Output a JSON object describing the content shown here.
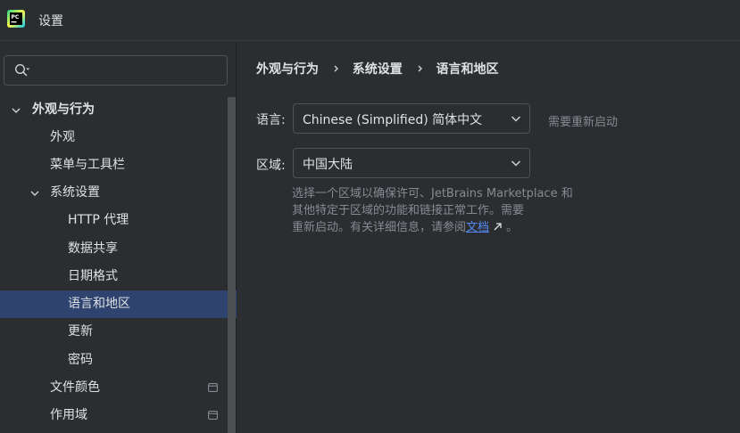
{
  "window": {
    "title": "设置",
    "app_icon": "pycharm-icon"
  },
  "search": {
    "placeholder": "",
    "value": "",
    "icon": "search-icon"
  },
  "sidebar": {
    "items": [
      {
        "label": "外观与行为",
        "level": 0,
        "expanded": true,
        "bold": true
      },
      {
        "label": "外观",
        "level": 1
      },
      {
        "label": "菜单与工具栏",
        "level": 1
      },
      {
        "label": "系统设置",
        "level": 1,
        "expanded": true
      },
      {
        "label": "HTTP 代理",
        "level": 2
      },
      {
        "label": "数据共享",
        "level": 2
      },
      {
        "label": "日期格式",
        "level": 2
      },
      {
        "label": "语言和地区",
        "level": 2,
        "selected": true
      },
      {
        "label": "更新",
        "level": 2
      },
      {
        "label": "密码",
        "level": 2
      },
      {
        "label": "文件颜色",
        "level": 1,
        "scope_icon": true
      },
      {
        "label": "作用域",
        "level": 1,
        "scope_icon": true
      }
    ]
  },
  "breadcrumb": [
    "外观与行为",
    "系统设置",
    "语言和地区"
  ],
  "language": {
    "label": "语言:",
    "value": "Chinese (Simplified) 简体中文",
    "note": "需要重新启动"
  },
  "region": {
    "label": "区域:",
    "value": "中国大陆"
  },
  "help": {
    "line1": "选择一个区域以确保许可、JetBrains Marketplace 和",
    "line2": "其他特定于区域的功能和链接正常工作。需要",
    "line3_prefix": "重新启动。有关详细信息，请参阅",
    "link": "文档",
    "line3_suffix": " 。"
  },
  "colors": {
    "background": "#2b2d30",
    "selected": "#2e436e",
    "link": "#548af7",
    "muted": "#868a91"
  }
}
